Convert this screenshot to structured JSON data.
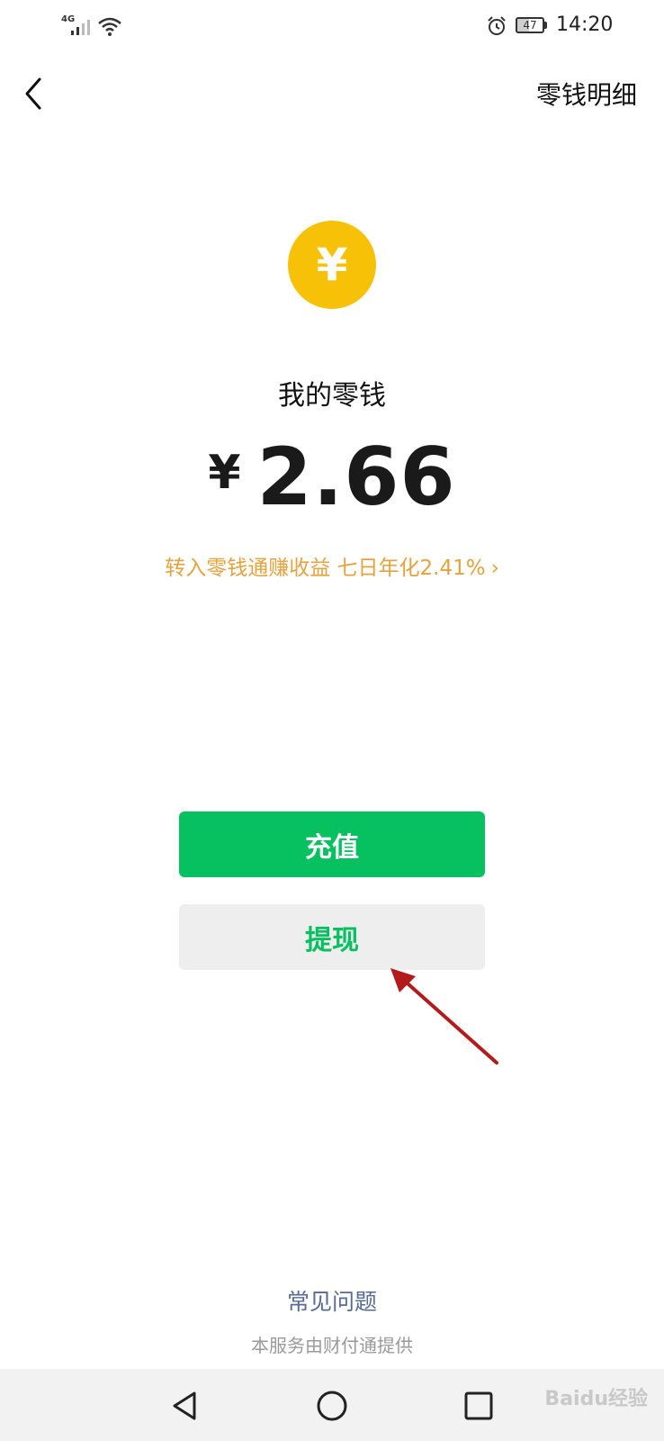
{
  "status_bar": {
    "network": "4G",
    "battery": "47",
    "time": "14:20",
    "icons": [
      "signal-icon",
      "wifi-icon",
      "alarm-icon",
      "battery-icon"
    ]
  },
  "header": {
    "back_icon": "chevron-left-icon",
    "detail_link": "零钱明细"
  },
  "wallet": {
    "coin_symbol": "¥",
    "label": "我的零钱",
    "currency": "¥",
    "amount": "2.66",
    "promo_text": "转入零钱通赚收益 七日年化2.41%",
    "promo_chevron": "›"
  },
  "actions": {
    "recharge_label": "充值",
    "withdraw_label": "提现"
  },
  "footer": {
    "faq": "常见问题",
    "provider": "本服务由财付通提供"
  },
  "system_nav": {
    "icons": [
      "nav-back-icon",
      "nav-home-icon",
      "nav-recent-icon"
    ],
    "watermark": "Baidu经验"
  },
  "colors": {
    "primary_green": "#07c160",
    "coin_yellow": "#f7c107",
    "promo_orange": "#e6a23c",
    "link_blue": "#576b95",
    "annotation_red": "#b31b1b"
  }
}
